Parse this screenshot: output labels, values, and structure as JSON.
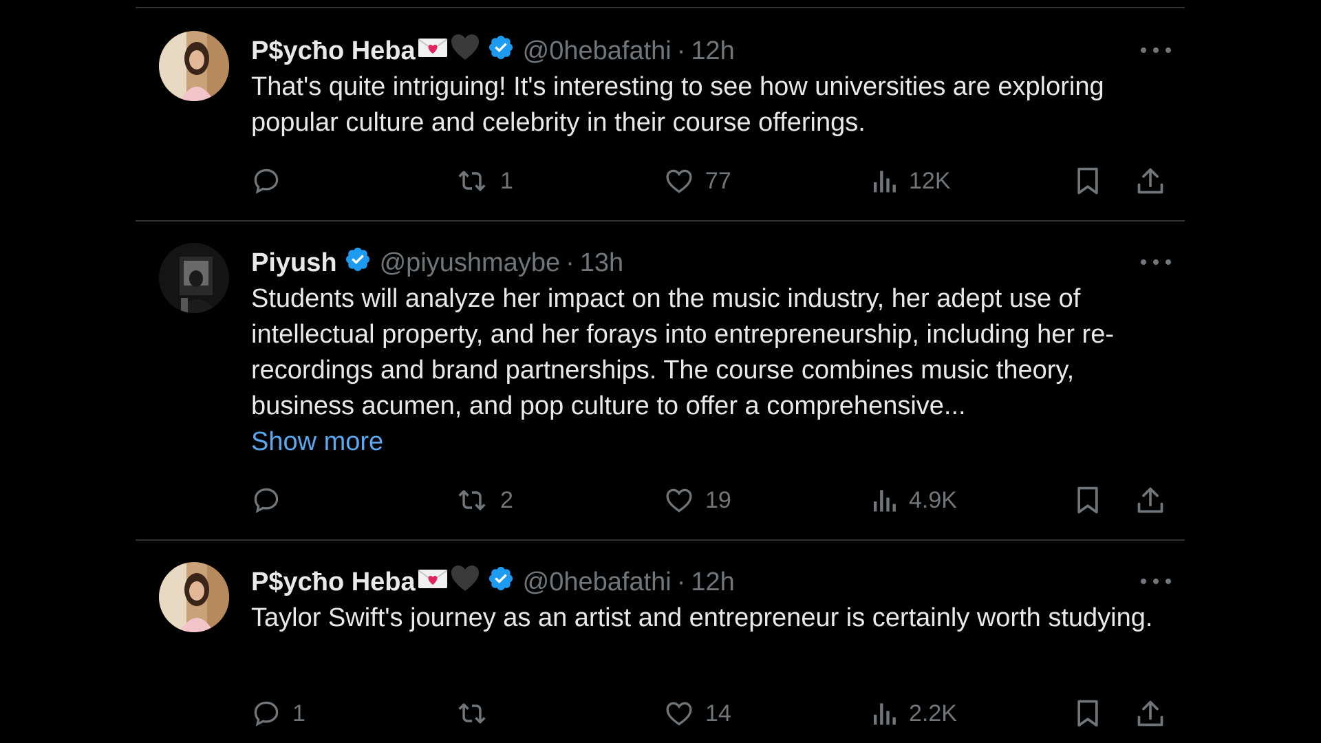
{
  "tweets": [
    {
      "display_name": "P$ycħo Heba",
      "handle": "@0hebafathi",
      "dot": "·",
      "time": "12h",
      "text": "That's quite intriguing! It's interesting to see how universities are exploring popular culture and celebrity in their course offerings.",
      "show_more": "",
      "reply_count": "",
      "retweet_count": "1",
      "like_count": "77",
      "view_count": "12K",
      "emojis": [
        "love-letter-icon",
        "black-heart-icon"
      ],
      "verified": true
    },
    {
      "display_name": "Piyush",
      "handle": "@piyushmaybe",
      "dot": "·",
      "time": "13h",
      "text": "Students will analyze her impact on the music industry, her adept use of intellectual property, and her forays into entrepreneurship, including her re-recordings and brand partnerships. The course combines music theory, business acumen, and pop culture to offer a comprehensive...",
      "show_more": "Show more",
      "reply_count": "",
      "retweet_count": "2",
      "like_count": "19",
      "view_count": "4.9K",
      "emojis": [],
      "verified": true
    },
    {
      "display_name": "P$ycħo Heba",
      "handle": "@0hebafathi",
      "dot": "·",
      "time": "12h",
      "text": "Taylor Swift's journey as an artist and entrepreneur is certainly worth studying.",
      "show_more": "",
      "reply_count": "1",
      "retweet_count": "",
      "like_count": "14",
      "view_count": "2.2K",
      "emojis": [
        "love-letter-icon",
        "black-heart-icon"
      ],
      "verified": true
    }
  ],
  "colors": {
    "background": "#000000",
    "text_primary": "#e7e9ea",
    "text_secondary": "#71767b",
    "link": "#5aa8f0",
    "verified_badge": "#1d9bf0",
    "divider": "#2f3336"
  },
  "icons": {
    "reply": "reply-icon",
    "retweet": "retweet-icon",
    "like": "heart-icon",
    "views": "views-icon",
    "bookmark": "bookmark-icon",
    "share": "share-icon",
    "more": "more-icon",
    "verified": "verified-badge-icon"
  }
}
